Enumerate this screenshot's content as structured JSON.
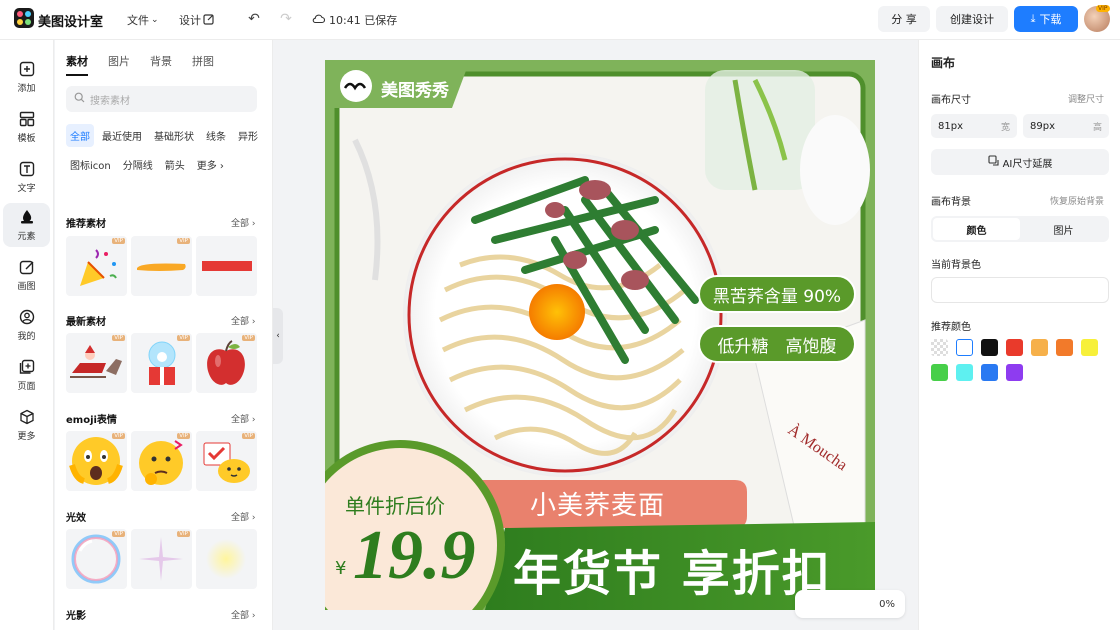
{
  "app": {
    "title": "美图设计室"
  },
  "topbar": {
    "menu_file": "文件",
    "menu_design": "设计",
    "save_status": "10:41 已保存",
    "share_label": "分 享",
    "create_label": "创建设计",
    "download_label": "下载",
    "avatar_badge": "VIP"
  },
  "rail": [
    {
      "label": "添加",
      "icon": "plus-square-icon"
    },
    {
      "label": "模板",
      "icon": "template-grid-icon"
    },
    {
      "label": "文字",
      "icon": "text-icon"
    },
    {
      "label": "元素",
      "icon": "shapes-icon"
    },
    {
      "label": "画图",
      "icon": "edit-icon"
    },
    {
      "label": "我的",
      "icon": "user-icon"
    },
    {
      "label": "页面",
      "icon": "page-add-icon"
    },
    {
      "label": "更多",
      "icon": "cube-icon"
    }
  ],
  "panel": {
    "tabs": [
      "素材",
      "图片",
      "背景",
      "拼图"
    ],
    "search_placeholder": "搜索素材",
    "chips": [
      "全部",
      "最近使用",
      "基础形状",
      "线条",
      "异形",
      "图标icon",
      "分隔线",
      "箭头",
      "更多"
    ],
    "sections": [
      {
        "title": "推荐素材",
        "all": "全部"
      },
      {
        "title": "最新素材",
        "all": "全部"
      },
      {
        "title": "emoji表情",
        "all": "全部"
      },
      {
        "title": "光效",
        "all": "全部"
      },
      {
        "title": "光影",
        "all": "全部"
      }
    ],
    "vip": "VIP"
  },
  "poster": {
    "brand": "美图秀秀",
    "tag1": "黑苦荞含量 90%",
    "tag2": "低升糖　高饱腹",
    "price_label": "单件折后价",
    "currency": "¥",
    "price": "19.9",
    "product": "小美荞麦面",
    "headline": "年货节 享折扣"
  },
  "canvas": {
    "zoom": "0%"
  },
  "right": {
    "title": "画布",
    "size_label": "画布尺寸",
    "size_link": "调整尺寸",
    "width_value": "81px",
    "width_unit": "宽",
    "height_value": "89px",
    "height_unit": "高",
    "ai_expand": "AI尺寸延展",
    "bg_label": "画布背景",
    "bg_reset": "恢复原始背景",
    "seg_color": "颜色",
    "seg_image": "图片",
    "current_bg": "当前背景色",
    "recommend": "推荐颜色",
    "swatches": [
      "transparent",
      "#ffffff",
      "#111111",
      "#e93a2b",
      "#f6b04a",
      "#f27a2a",
      "#f7f03a",
      "#47cf49",
      "#5ef0f0",
      "#2979f2",
      "#8e3cf0"
    ]
  }
}
